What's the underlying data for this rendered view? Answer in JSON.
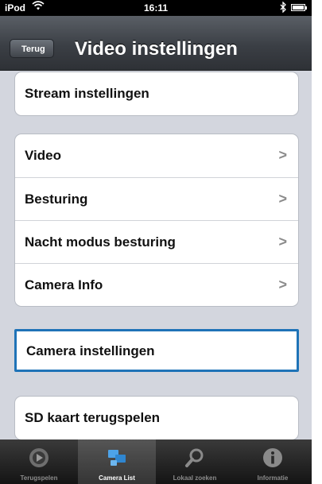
{
  "status_bar": {
    "carrier": "iPod",
    "time": "16:11"
  },
  "nav": {
    "back_label": "Terug",
    "title": "Video instellingen"
  },
  "groups": [
    {
      "items": [
        {
          "label": "Stream instellingen",
          "chevron": false
        }
      ]
    },
    {
      "items": [
        {
          "label": "Video",
          "chevron": true
        },
        {
          "label": "Besturing",
          "chevron": true
        },
        {
          "label": "Nacht modus besturing",
          "chevron": true
        },
        {
          "label": "Camera Info",
          "chevron": true
        }
      ]
    },
    {
      "items": [
        {
          "label": "Camera instellingen",
          "chevron": false,
          "selected": true
        }
      ]
    },
    {
      "items": [
        {
          "label": "SD kaart terugspelen",
          "chevron": false
        }
      ]
    }
  ],
  "chevron_glyph": ">",
  "tabs": [
    {
      "label": "Terugspelen",
      "icon": "playback-icon",
      "active": false
    },
    {
      "label": "Camera List",
      "icon": "camera-list-icon",
      "active": true
    },
    {
      "label": "Lokaal zoeken",
      "icon": "search-icon",
      "active": false
    },
    {
      "label": "Informatie",
      "icon": "info-icon",
      "active": false
    }
  ],
  "colors": {
    "selection_border": "#1f73b7",
    "background": "#d3d6de",
    "navbar": "#3b3f45"
  }
}
